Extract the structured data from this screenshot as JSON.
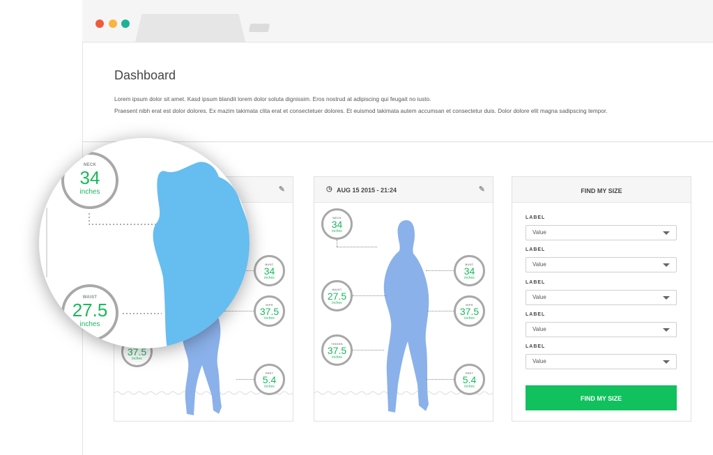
{
  "window": {
    "buttons": {
      "close": "#ef5350",
      "minimize": "#f7b733",
      "maximize": "#1abc9c"
    }
  },
  "header": {
    "title": "Dashboard"
  },
  "intro": {
    "line1": "Lorem ipsum dolor sit amet. Kasd ipsum blandit lorem dolor soluta dignissim. Eros nostrud at adipiscing qui feugait no iusto.",
    "line2": "Praesent nibh erat est dolor dolores. Ex mazim takimata clita erat et consectetuer dolores. Et euismod takimata autem accumsan et consectetur duis. Dolor dolore elit magna sadipscing tempor."
  },
  "colors": {
    "accent": "#10c15e",
    "value_green": "#18b95a",
    "silhouette": "#8bb1ea",
    "silhouette_zoom": "#66bdf0"
  },
  "card1": {
    "icons": {
      "edit": "pencil-icon"
    },
    "measurements": {
      "bust": {
        "label": "BUST",
        "value": "34",
        "unit": "inches"
      },
      "hips": {
        "label": "HIPS",
        "value": "37.5",
        "unit": "inches"
      },
      "thighs": {
        "value": "37.5",
        "unit": "inches"
      },
      "feet": {
        "label": "FEET",
        "value": "5.4",
        "unit": "inches"
      }
    }
  },
  "card2": {
    "date": "AUG 15 2015 - 21:24",
    "icons": {
      "clock": "clock-icon",
      "edit": "pencil-icon"
    },
    "measurements": {
      "neck": {
        "label": "NECK",
        "value": "34",
        "unit": "inches"
      },
      "bust": {
        "label": "BUST",
        "value": "34",
        "unit": "inches"
      },
      "waist": {
        "label": "WAIST",
        "value": "27.5",
        "unit": "inches"
      },
      "hips": {
        "label": "HIPS",
        "value": "37.5",
        "unit": "inches"
      },
      "thighs": {
        "label": "THIGHS",
        "value": "37.5",
        "unit": "inches"
      },
      "feet": {
        "label": "FEET",
        "value": "5.4",
        "unit": "inches"
      }
    }
  },
  "size_finder": {
    "title": "FIND MY SIZE",
    "fields": [
      {
        "label": "LABEL",
        "value": "Value"
      },
      {
        "label": "LABEL",
        "value": "Value"
      },
      {
        "label": "LABEL",
        "value": "Value"
      },
      {
        "label": "LABEL",
        "value": "Value"
      },
      {
        "label": "LABEL",
        "value": "Value"
      }
    ],
    "button": "FIND MY SIZE"
  },
  "zoom": {
    "neck": {
      "label": "NECK",
      "value": "34",
      "unit": "inches"
    },
    "waist": {
      "label": "WAIST",
      "value": "27.5",
      "unit": "inches"
    }
  }
}
